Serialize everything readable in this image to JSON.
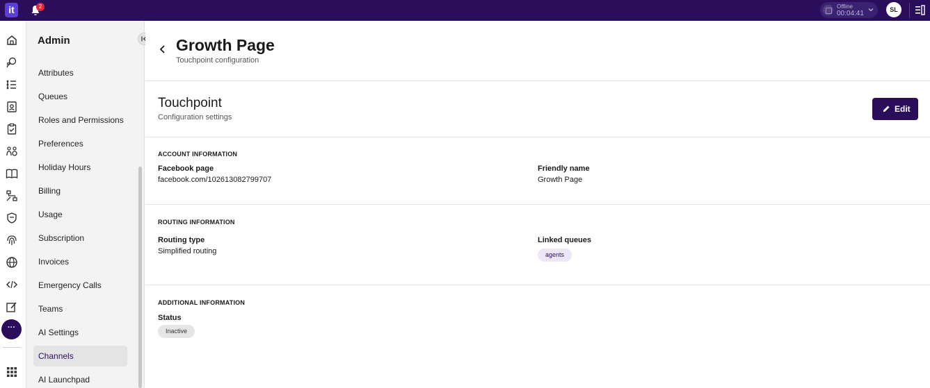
{
  "topbar": {
    "logo_text": "it",
    "notifications_count": "2",
    "status": {
      "label": "Offline",
      "timer": "00:04:41"
    },
    "user_initials": "SL"
  },
  "rail": {
    "icons": [
      "home-icon",
      "conversations-icon",
      "list-icon",
      "contacts-icon",
      "tasks-icon",
      "teams-icon",
      "knowledge-icon",
      "flows-icon",
      "shield-icon",
      "fingerprint-icon",
      "globe-icon",
      "code-icon",
      "edit-note-icon"
    ],
    "more_label": "···",
    "apps_icon": "apps-grid-icon"
  },
  "sidebar": {
    "title": "Admin",
    "items": [
      {
        "label": "Attributes",
        "active": false
      },
      {
        "label": "Queues",
        "active": false
      },
      {
        "label": "Roles and Permissions",
        "active": false
      },
      {
        "label": "Preferences",
        "active": false
      },
      {
        "label": "Holiday Hours",
        "active": false
      },
      {
        "label": "Billing",
        "active": false
      },
      {
        "label": "Usage",
        "active": false
      },
      {
        "label": "Subscription",
        "active": false
      },
      {
        "label": "Invoices",
        "active": false
      },
      {
        "label": "Emergency Calls",
        "active": false
      },
      {
        "label": "Teams",
        "active": false
      },
      {
        "label": "AI Settings",
        "active": false
      },
      {
        "label": "Channels",
        "active": true
      },
      {
        "label": "AI Launchpad",
        "active": false
      }
    ]
  },
  "header": {
    "title": "Growth Page",
    "subtitle": "Touchpoint configuration"
  },
  "section": {
    "title": "Touchpoint",
    "subtitle": "Configuration settings",
    "edit_label": "Edit"
  },
  "account": {
    "group_title": "ACCOUNT INFORMATION",
    "facebook_label": "Facebook page",
    "facebook_value": "facebook.com/102613082799707",
    "friendly_label": "Friendly name",
    "friendly_value": "Growth Page"
  },
  "routing": {
    "group_title": "ROUTING INFORMATION",
    "type_label": "Routing type",
    "type_value": "Simplified routing",
    "queues_label": "Linked queues",
    "queues": [
      "agents"
    ]
  },
  "additional": {
    "group_title": "ADDITIONAL INFORMATION",
    "status_label": "Status",
    "status_value": "Inactive"
  },
  "colors": {
    "brand": "#2a0e5c",
    "logo": "#5b3fd6",
    "badge": "#e0263a"
  }
}
